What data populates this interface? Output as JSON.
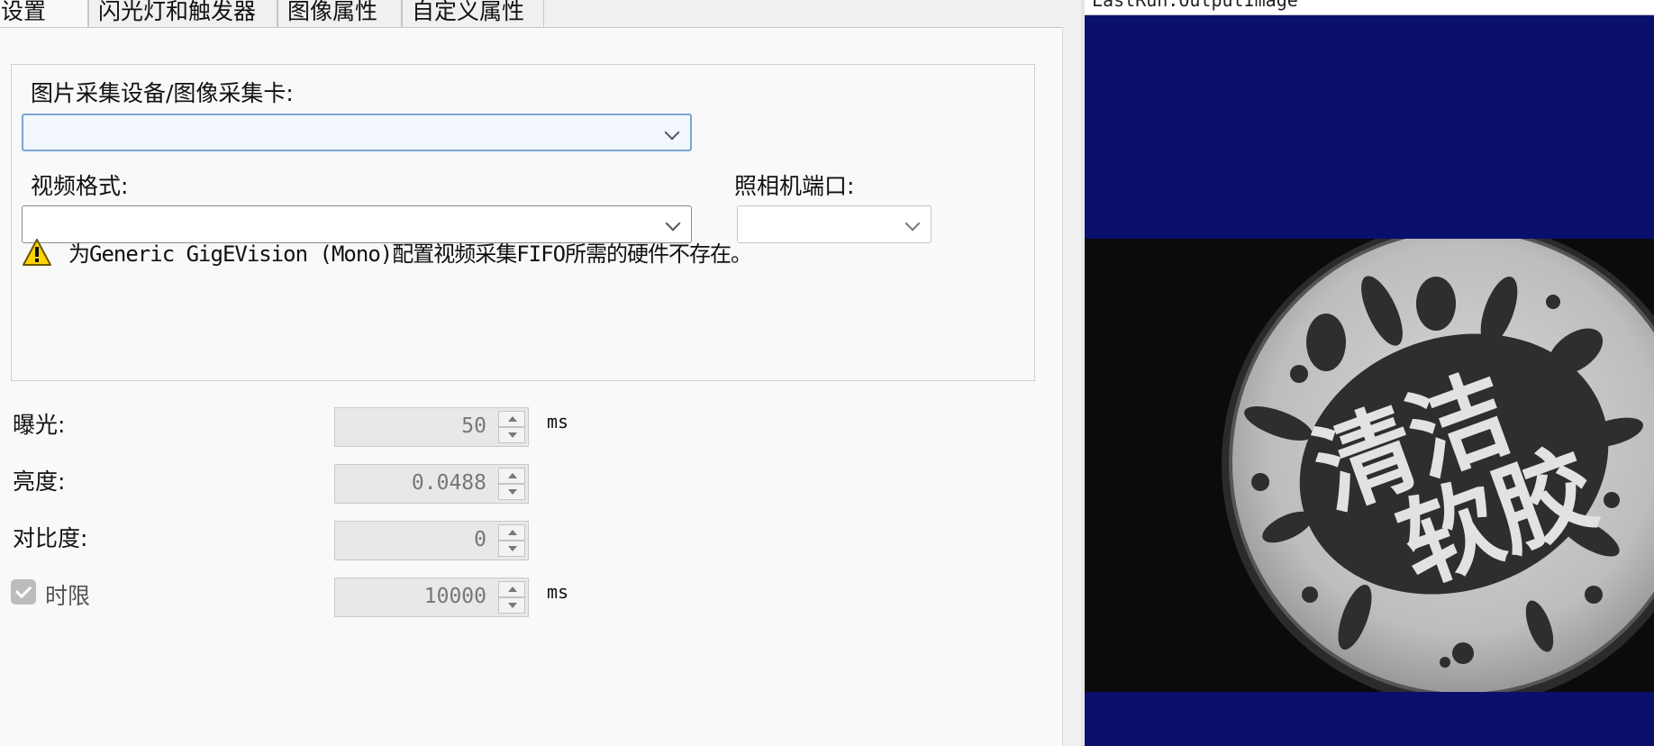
{
  "tabs": [
    {
      "label": "设置",
      "active": true
    },
    {
      "label": "闪光灯和触发器",
      "active": false
    },
    {
      "label": "图像属性",
      "active": false
    },
    {
      "label": "自定义属性",
      "active": false
    }
  ],
  "acquisition": {
    "device_label": "图片采集设备/图像采集卡:",
    "device_value": "",
    "video_format_label": "视频格式:",
    "video_format_value": "",
    "camera_port_label": "照相机端口:",
    "camera_port_value": "",
    "warning_text": "为Generic GigEVision (Mono)配置视频采集FIFO所需的硬件不存在。",
    "warning_icon": "warning-triangle-icon"
  },
  "properties": {
    "exposure": {
      "label": "曝光:",
      "value": "50",
      "unit": "ms"
    },
    "brightness": {
      "label": "亮度:",
      "value": "0.0488"
    },
    "contrast": {
      "label": "对比度:",
      "value": "0"
    },
    "timeout": {
      "label": "时限",
      "value": "10000",
      "unit": "ms",
      "checked": true
    }
  },
  "viewer": {
    "title": "LastRun.OutputImage",
    "image_text_top": "清洁",
    "image_text_bottom": "软胶",
    "background_color": "#0a0f6e"
  }
}
